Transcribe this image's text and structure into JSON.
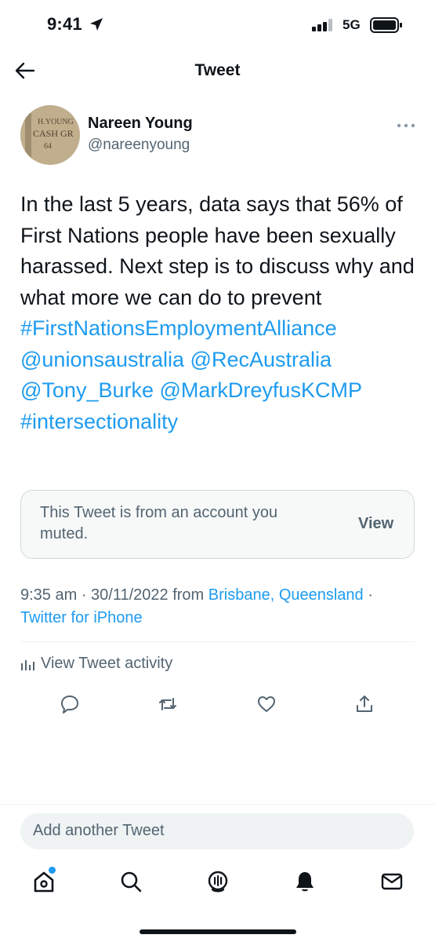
{
  "status_bar": {
    "time": "9:41",
    "network": "5G"
  },
  "header": {
    "title": "Tweet"
  },
  "author": {
    "name": "Nareen Young",
    "handle": "@nareenyoung"
  },
  "tweet": {
    "text_plain": "In the last 5 years, data says that 56% of First Nations people have been sexually harassed. Next step is to discuss why and what more we can do to prevent",
    "links": [
      "#FirstNationsEmploymentAlliance",
      "@unionsaustralia",
      "@RecAustralia",
      "@Tony_Burke",
      "@MarkDreyfusKCMP",
      "#intersectionality"
    ]
  },
  "muted_notice": {
    "text": "This Tweet is from an account you muted.",
    "button": "View"
  },
  "meta": {
    "time_date": "9:35 am · 30/11/2022 from ",
    "location": "Brisbane, Queensland",
    "separator": " ·",
    "source": "Twitter for iPhone"
  },
  "activity": {
    "label": "View Tweet activity"
  },
  "actions": [
    "reply-icon",
    "retweet-icon",
    "like-icon",
    "share-icon"
  ],
  "composer": {
    "placeholder": "Add another Tweet"
  },
  "bottom_nav": [
    "home-icon",
    "search-icon",
    "spaces-icon",
    "notifications-icon",
    "messages-icon"
  ],
  "colors": {
    "accent": "#1d9bf0",
    "text": "#0f1419",
    "secondary": "#536471"
  }
}
